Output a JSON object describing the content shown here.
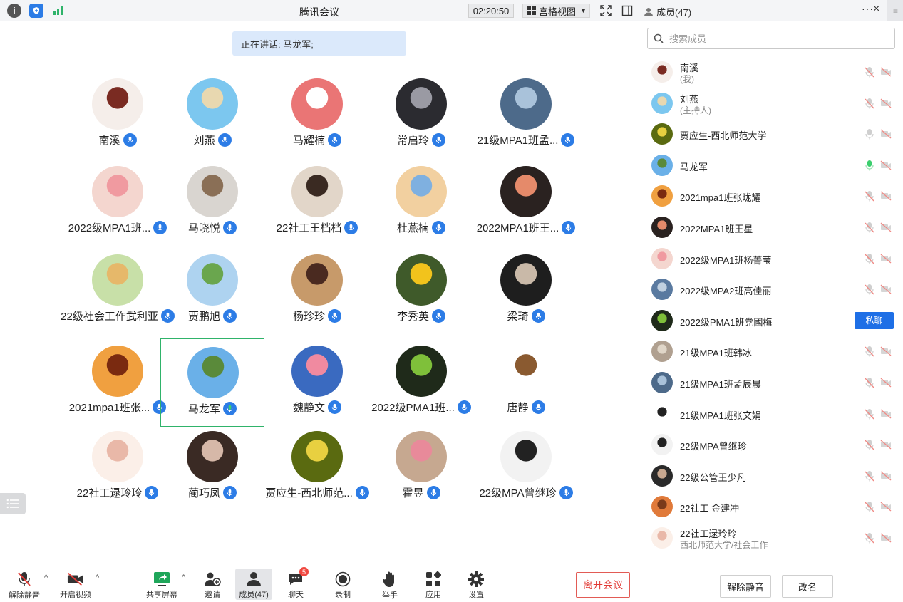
{
  "titlebar": {
    "title": "腾讯会议",
    "timer": "02:20:50",
    "view_mode": "宫格视图"
  },
  "speaking": {
    "text": "正在讲话: 马龙军;"
  },
  "grid": [
    {
      "name": "南溪",
      "colors": [
        "#f5eeea",
        "#7a2b22"
      ],
      "speaking": false
    },
    {
      "name": "刘燕",
      "colors": [
        "#7cc7ef",
        "#e8d8b0"
      ],
      "speaking": false
    },
    {
      "name": "马耀楠",
      "colors": [
        "#ea7575",
        "#ffffff"
      ],
      "speaking": false
    },
    {
      "name": "常启玲",
      "colors": [
        "#2b2b30",
        "#9a9aa3"
      ],
      "speaking": false
    },
    {
      "name": "21级MPA1班孟...",
      "colors": [
        "#4d6a8a",
        "#a9c2da"
      ],
      "speaking": false
    },
    {
      "name": "2022级MPA1班...",
      "colors": [
        "#f4d6cf",
        "#f09aa0"
      ],
      "speaking": false
    },
    {
      "name": "马晓悦",
      "colors": [
        "#d9d5d0",
        "#8a6f56"
      ],
      "speaking": false
    },
    {
      "name": "22社工王档档",
      "colors": [
        "#e2d6c9",
        "#3a2a22"
      ],
      "speaking": false
    },
    {
      "name": "杜燕楠",
      "colors": [
        "#f2d0a0",
        "#7fb0e0"
      ],
      "speaking": false
    },
    {
      "name": "2022MPA1班王...",
      "colors": [
        "#2a2220",
        "#e58a6a"
      ],
      "speaking": false
    },
    {
      "name": "22级社会工作武利亚",
      "colors": [
        "#c8e0a8",
        "#e6b86a"
      ],
      "speaking": false
    },
    {
      "name": "贾鹏旭",
      "colors": [
        "#aed3f0",
        "#6aa64e"
      ],
      "speaking": false
    },
    {
      "name": "杨珍珍",
      "colors": [
        "#c79a6a",
        "#4a2a20"
      ],
      "speaking": false
    },
    {
      "name": "李秀英",
      "colors": [
        "#3f5a2a",
        "#f2c31c"
      ],
      "speaking": false
    },
    {
      "name": "梁琦",
      "colors": [
        "#1e1e1e",
        "#c9b9a8"
      ],
      "speaking": false
    },
    {
      "name": "2021mpa1班张...",
      "colors": [
        "#f0a040",
        "#7a2a10"
      ],
      "speaking": false
    },
    {
      "name": "马龙军",
      "colors": [
        "#6ab0e8",
        "#5a8a3a"
      ],
      "speaking": true
    },
    {
      "name": "魏静文",
      "colors": [
        "#3a6ac0",
        "#f08aa0"
      ],
      "speaking": false
    },
    {
      "name": "2022级PMA1班...",
      "colors": [
        "#1f2a1a",
        "#7fc03a"
      ],
      "speaking": false
    },
    {
      "name": "唐静",
      "colors": [
        "#ffffff",
        "#8a5a30"
      ],
      "speaking": false
    },
    {
      "name": "22社工逯玲玲",
      "colors": [
        "#fbefe8",
        "#e9b8a8"
      ],
      "speaking": false
    },
    {
      "name": "蔺巧凤",
      "colors": [
        "#3a2a24",
        "#d6b8a8"
      ],
      "speaking": false
    },
    {
      "name": "贾应生-西北师范...",
      "colors": [
        "#5a6a10",
        "#e8d040"
      ],
      "speaking": false
    },
    {
      "name": "霍昱",
      "colors": [
        "#c6a890",
        "#e88a9a"
      ],
      "speaking": false
    },
    {
      "name": "22级MPA曾继珍",
      "colors": [
        "#f2f2f2",
        "#222222"
      ],
      "speaking": false
    }
  ],
  "toolbar": {
    "unmute": "解除静音",
    "start_video": "开启视频",
    "share_screen": "共享屏幕",
    "invite": "邀请",
    "members": "成员(47)",
    "chat": "聊天",
    "chat_badge": "5",
    "record": "录制",
    "raise_hand": "举手",
    "apps": "应用",
    "settings": "设置",
    "leave": "离开会议"
  },
  "panel": {
    "title": "成员(47)",
    "more": "···",
    "close": "×",
    "search_placeholder": "搜索成员",
    "members": [
      {
        "name": "南溪",
        "sub": "(我)",
        "colors": [
          "#f5eeea",
          "#7a2b22"
        ],
        "mic": "muted"
      },
      {
        "name": "刘燕",
        "sub": "(主持人)",
        "colors": [
          "#7cc7ef",
          "#e8d8b0"
        ],
        "mic": "muted"
      },
      {
        "name": "贾应生-西北师范大学",
        "sub": "",
        "colors": [
          "#5a6a10",
          "#e8d040"
        ],
        "mic": "off"
      },
      {
        "name": "马龙军",
        "sub": "",
        "colors": [
          "#6ab0e8",
          "#5a8a3a"
        ],
        "mic": "active"
      },
      {
        "name": "2021mpa1班张珑耀",
        "sub": "",
        "colors": [
          "#f0a040",
          "#7a2a10"
        ],
        "mic": "muted"
      },
      {
        "name": "2022MPA1班王星",
        "sub": "",
        "colors": [
          "#2a2220",
          "#e58a6a"
        ],
        "mic": "muted"
      },
      {
        "name": "2022级MPA1班杨菁莹",
        "sub": "",
        "colors": [
          "#f4d6cf",
          "#f09aa0"
        ],
        "mic": "muted"
      },
      {
        "name": "2022级MPA2班高佳丽",
        "sub": "",
        "colors": [
          "#5a7aa0",
          "#c0d0e0"
        ],
        "mic": "muted"
      },
      {
        "name": "2022级PMA1班党國梅",
        "sub": "",
        "colors": [
          "#1f2a1a",
          "#7fc03a"
        ],
        "mic": "chat",
        "chat_label": "私聊"
      },
      {
        "name": "21级MPA1班韩冰",
        "sub": "",
        "colors": [
          "#b0a090",
          "#e0d6c8"
        ],
        "mic": "muted"
      },
      {
        "name": "21级MPA1班孟辰晨",
        "sub": "",
        "colors": [
          "#4d6a8a",
          "#a9c2da"
        ],
        "mic": "muted"
      },
      {
        "name": "21级MPA1班张文娟",
        "sub": "",
        "colors": [
          "#ffffff",
          "#222222"
        ],
        "mic": "muted"
      },
      {
        "name": "22级MPA曾继珍",
        "sub": "",
        "colors": [
          "#f2f2f2",
          "#222222"
        ],
        "mic": "muted"
      },
      {
        "name": "22级公管王少凡",
        "sub": "",
        "colors": [
          "#2a2a2a",
          "#c8a890"
        ],
        "mic": "muted"
      },
      {
        "name": "22社工 金建冲",
        "sub": "",
        "colors": [
          "#e07a3a",
          "#7a3a1a"
        ],
        "mic": "muted"
      },
      {
        "name": "22社工逯玲玲",
        "sub": "西北师范大学/社会工作",
        "colors": [
          "#fbefe8",
          "#e9b8a8"
        ],
        "mic": "muted"
      }
    ],
    "unmute_all": "解除静音",
    "rename": "改名"
  }
}
